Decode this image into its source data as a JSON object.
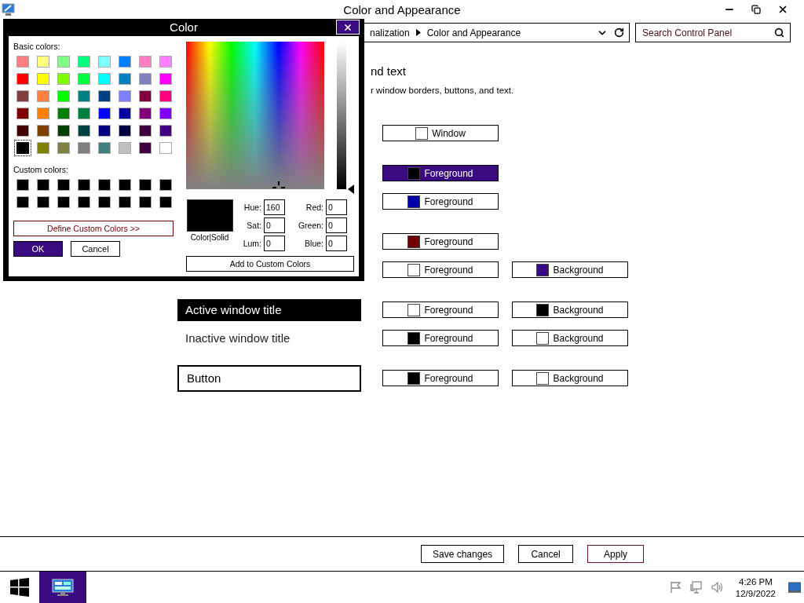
{
  "window": {
    "title": "Color and Appearance"
  },
  "address_bar": {
    "breadcrumbs": [
      "nalization",
      "Color and Appearance"
    ]
  },
  "search": {
    "placeholder": "Search Control Panel"
  },
  "header": {
    "title": "nd text",
    "description": "r window borders, buttons, and text."
  },
  "sections": [
    {
      "rows": [
        {
          "swatches": [
            {
              "label": "Window",
              "color": "#ffffff",
              "selected": false
            }
          ]
        }
      ]
    },
    {
      "rows": [
        {
          "swatches": [
            {
              "label": "Foreground",
              "color": "#000000",
              "selected": true
            }
          ]
        },
        {
          "swatches": [
            {
              "label": "Foreground",
              "color": "#0000a8",
              "selected": false
            }
          ]
        }
      ]
    },
    {
      "rows": [
        {
          "swatches": [
            {
              "label": "Foreground",
              "color": "#700000",
              "selected": false
            }
          ]
        },
        {
          "swatches": [
            {
              "label": "Foreground",
              "color": "#ffffff",
              "selected": false
            },
            {
              "label": "Background",
              "color": "#3a0a80",
              "selected": false
            }
          ]
        }
      ]
    },
    {
      "rows": [
        {
          "preview": {
            "kind": "active",
            "label": "Active window title"
          },
          "swatches": [
            {
              "label": "Foreground",
              "color": "#ffffff",
              "selected": false
            },
            {
              "label": "Background",
              "color": "#000000",
              "selected": false
            }
          ]
        },
        {
          "preview": {
            "kind": "inactive",
            "label": "Inactive window title"
          },
          "swatches": [
            {
              "label": "Foreground",
              "color": "#000000",
              "selected": false
            },
            {
              "label": "Background",
              "color": "#ffffff",
              "selected": false
            }
          ]
        }
      ]
    },
    {
      "rows": [
        {
          "preview": {
            "kind": "button",
            "label": "Button"
          },
          "swatches": [
            {
              "label": "Foreground",
              "color": "#000000",
              "selected": false
            },
            {
              "label": "Background",
              "color": "#ffffff",
              "selected": false
            }
          ]
        }
      ]
    }
  ],
  "footer": {
    "buttons": [
      {
        "label": "Save changes",
        "kind": "normal"
      },
      {
        "label": "Cancel",
        "kind": "normal"
      },
      {
        "label": "Apply",
        "kind": "default"
      }
    ]
  },
  "taskbar": {
    "apps": [
      {
        "selected": true
      }
    ],
    "clock": {
      "time": "4:26 PM",
      "date": "12/9/2022"
    }
  },
  "color_dialog": {
    "title": "Color",
    "basic_colors_label": "Basic colors:",
    "basic_colors": [
      {
        "color": "#ff8080",
        "selected": false
      },
      {
        "color": "#ffff80",
        "selected": false
      },
      {
        "color": "#80ff80",
        "selected": false
      },
      {
        "color": "#00ff80",
        "selected": false
      },
      {
        "color": "#80ffff",
        "selected": false
      },
      {
        "color": "#0080ff",
        "selected": false
      },
      {
        "color": "#ff80c0",
        "selected": false
      },
      {
        "color": "#ff80ff",
        "selected": false
      },
      {
        "color": "#ff0000",
        "selected": false
      },
      {
        "color": "#ffff00",
        "selected": false
      },
      {
        "color": "#80ff00",
        "selected": false
      },
      {
        "color": "#00ff40",
        "selected": false
      },
      {
        "color": "#00ffff",
        "selected": false
      },
      {
        "color": "#0080c0",
        "selected": false
      },
      {
        "color": "#8080c0",
        "selected": false
      },
      {
        "color": "#ff00ff",
        "selected": false
      },
      {
        "color": "#804040",
        "selected": false
      },
      {
        "color": "#ff8040",
        "selected": false
      },
      {
        "color": "#00ff00",
        "selected": false
      },
      {
        "color": "#008080",
        "selected": false
      },
      {
        "color": "#004080",
        "selected": false
      },
      {
        "color": "#8080ff",
        "selected": false
      },
      {
        "color": "#800040",
        "selected": false
      },
      {
        "color": "#ff0080",
        "selected": false
      },
      {
        "color": "#800000",
        "selected": false
      },
      {
        "color": "#ff8000",
        "selected": false
      },
      {
        "color": "#008000",
        "selected": false
      },
      {
        "color": "#008040",
        "selected": false
      },
      {
        "color": "#0000ff",
        "selected": false
      },
      {
        "color": "#0000a0",
        "selected": false
      },
      {
        "color": "#800080",
        "selected": false
      },
      {
        "color": "#8000ff",
        "selected": false
      },
      {
        "color": "#400000",
        "selected": false
      },
      {
        "color": "#804000",
        "selected": false
      },
      {
        "color": "#004000",
        "selected": false
      },
      {
        "color": "#004040",
        "selected": false
      },
      {
        "color": "#000080",
        "selected": false
      },
      {
        "color": "#000040",
        "selected": false
      },
      {
        "color": "#400040",
        "selected": false
      },
      {
        "color": "#400080",
        "selected": false
      },
      {
        "color": "#000000",
        "selected": true
      },
      {
        "color": "#808000",
        "selected": false
      },
      {
        "color": "#808040",
        "selected": false
      },
      {
        "color": "#808080",
        "selected": false
      },
      {
        "color": "#408080",
        "selected": false
      },
      {
        "color": "#c0c0c0",
        "selected": false
      },
      {
        "color": "#400040",
        "selected": false
      },
      {
        "color": "#ffffff",
        "selected": false
      }
    ],
    "custom_colors_label": "Custom colors:",
    "custom_colors": [
      {
        "color": "#000000"
      },
      {
        "color": "#000000"
      },
      {
        "color": "#000000"
      },
      {
        "color": "#000000"
      },
      {
        "color": "#000000"
      },
      {
        "color": "#000000"
      },
      {
        "color": "#000000"
      },
      {
        "color": "#000000"
      },
      {
        "color": "#000000"
      },
      {
        "color": "#000000"
      },
      {
        "color": "#000000"
      },
      {
        "color": "#000000"
      },
      {
        "color": "#000000"
      },
      {
        "color": "#000000"
      },
      {
        "color": "#000000"
      },
      {
        "color": "#000000"
      }
    ],
    "define_button": "Define Custom Colors >>",
    "ok_button": "OK",
    "cancel_button": "Cancel",
    "luminance": {
      "level": 0
    },
    "preview_label": "Color|Solid",
    "fields": [
      {
        "label": "Hue:",
        "value": "160"
      },
      {
        "label": "Red:",
        "value": "0"
      },
      {
        "label": "Sat:",
        "value": "0"
      },
      {
        "label": "Green:",
        "value": "0"
      },
      {
        "label": "Lum:",
        "value": "0"
      },
      {
        "label": "Blue:",
        "value": "0"
      }
    ],
    "add_button": "Add to Custom Colors"
  }
}
